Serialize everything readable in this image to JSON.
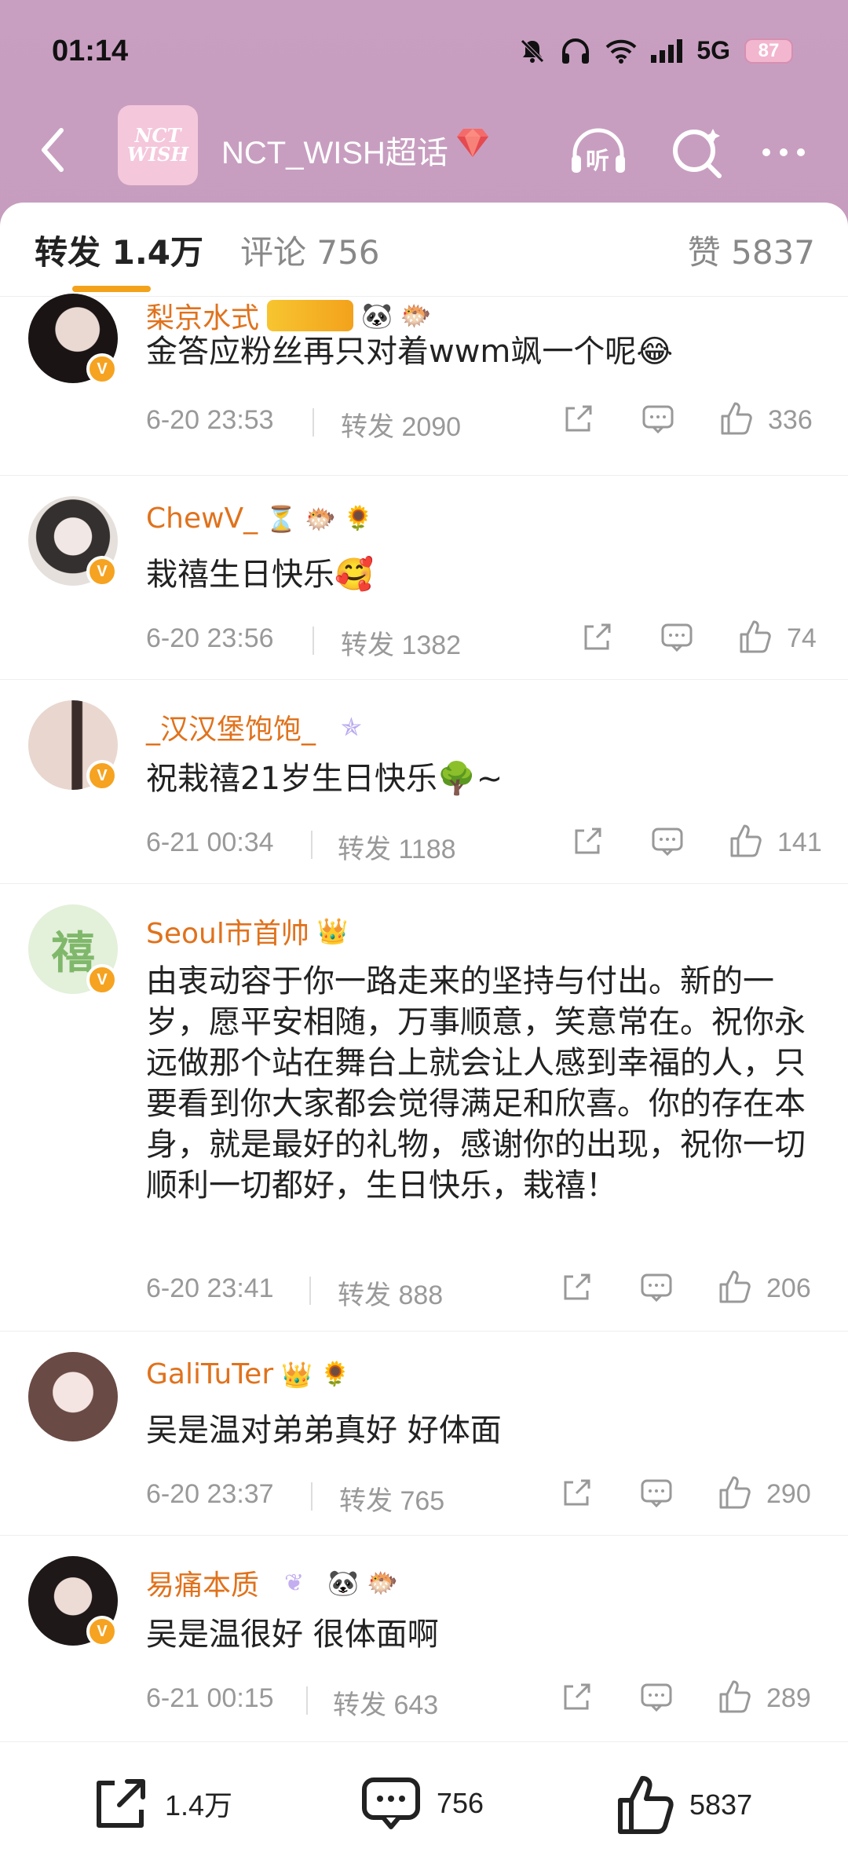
{
  "status": {
    "time": "01:14",
    "network": "5G",
    "battery": "87"
  },
  "header": {
    "title": "NCT_WISH超话",
    "logo_text": "NCT WISH",
    "listen_label": "听"
  },
  "tabs": {
    "forward": "转发 1.4万",
    "comment": "评论 756",
    "like": "赞 5837"
  },
  "comments": [
    {
      "name": "梨京水式",
      "text": "金答应粉丝再只对着wwm飒一个呢😂",
      "date": "6-20 23:53",
      "forward": "转发 2090",
      "likes": "336"
    },
    {
      "name": "ChewV_",
      "text": "栽禧生日快乐🥰",
      "date": "6-20 23:56",
      "forward": "转发 1382",
      "likes": "74"
    },
    {
      "name": "_汉汉堡饱饱_",
      "text": "祝栽禧21岁生日快乐🌳~",
      "date": "6-21 00:34",
      "forward": "转发 1188",
      "likes": "141"
    },
    {
      "name": "Seoul市首帅",
      "text": "由衷动容于你一路走来的坚持与付出。新的一岁，愿平安相随，万事顺意，笑意常在。祝你永远做那个站在舞台上就会让人感到幸福的人，只要看到你大家都会觉得满足和欣喜。你的存在本身，就是最好的礼物，感谢你的出现，祝你一切顺利一切都好，生日快乐，栽禧！",
      "date": "6-20 23:41",
      "forward": "转发 888",
      "likes": "206"
    },
    {
      "name": "GaliTuTer",
      "text": "吴是温对弟弟真好 好体面",
      "date": "6-20 23:37",
      "forward": "转发 765",
      "likes": "290"
    },
    {
      "name": "易痛本质",
      "text": "吴是温很好 很体面啊",
      "date": "6-21 00:15",
      "forward": "转发 643",
      "likes": "289"
    }
  ],
  "bottom": {
    "forward": "1.4万",
    "comment": "756",
    "like": "5837"
  },
  "colors": {
    "accent": "#f3a21c",
    "username": "#e0721c",
    "header_bg": "#c89fc1"
  }
}
